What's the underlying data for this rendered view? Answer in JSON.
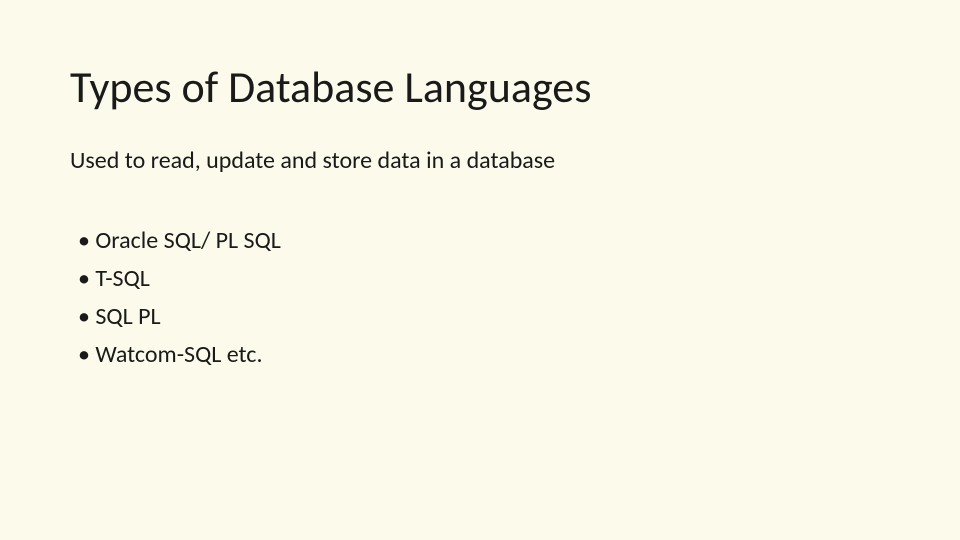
{
  "slide": {
    "title": "Types of Database Languages",
    "subtitle": "Used to read, update and store data in a database",
    "bullets": [
      "Oracle SQL/ PL SQL",
      "T-SQL",
      "SQL PL",
      "Watcom-SQL etc."
    ]
  }
}
